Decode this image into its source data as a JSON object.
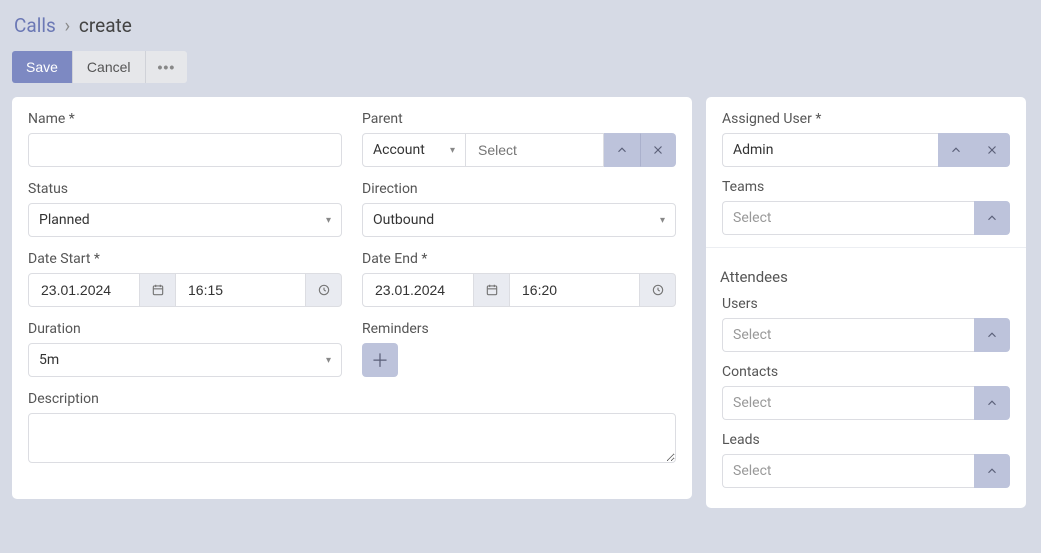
{
  "breadcrumb": {
    "module": "Calls",
    "page": "create"
  },
  "toolbar": {
    "save": "Save",
    "cancel": "Cancel"
  },
  "fields": {
    "name": {
      "label": "Name *",
      "value": ""
    },
    "parent": {
      "label": "Parent",
      "type": "Account",
      "value": "",
      "placeholder": "Select"
    },
    "status": {
      "label": "Status",
      "value": "Planned"
    },
    "direction": {
      "label": "Direction",
      "value": "Outbound"
    },
    "dateStart": {
      "label": "Date Start *",
      "date": "23.01.2024",
      "time": "16:15"
    },
    "dateEnd": {
      "label": "Date End *",
      "date": "23.01.2024",
      "time": "16:20"
    },
    "duration": {
      "label": "Duration",
      "value": "5m"
    },
    "reminders": {
      "label": "Reminders"
    },
    "description": {
      "label": "Description",
      "value": ""
    }
  },
  "side": {
    "assignedUser": {
      "label": "Assigned User *",
      "value": "Admin"
    },
    "teams": {
      "label": "Teams",
      "placeholder": "Select"
    },
    "attendeesTitle": "Attendees",
    "users": {
      "label": "Users",
      "placeholder": "Select"
    },
    "contacts": {
      "label": "Contacts",
      "placeholder": "Select"
    },
    "leads": {
      "label": "Leads",
      "placeholder": "Select"
    }
  }
}
